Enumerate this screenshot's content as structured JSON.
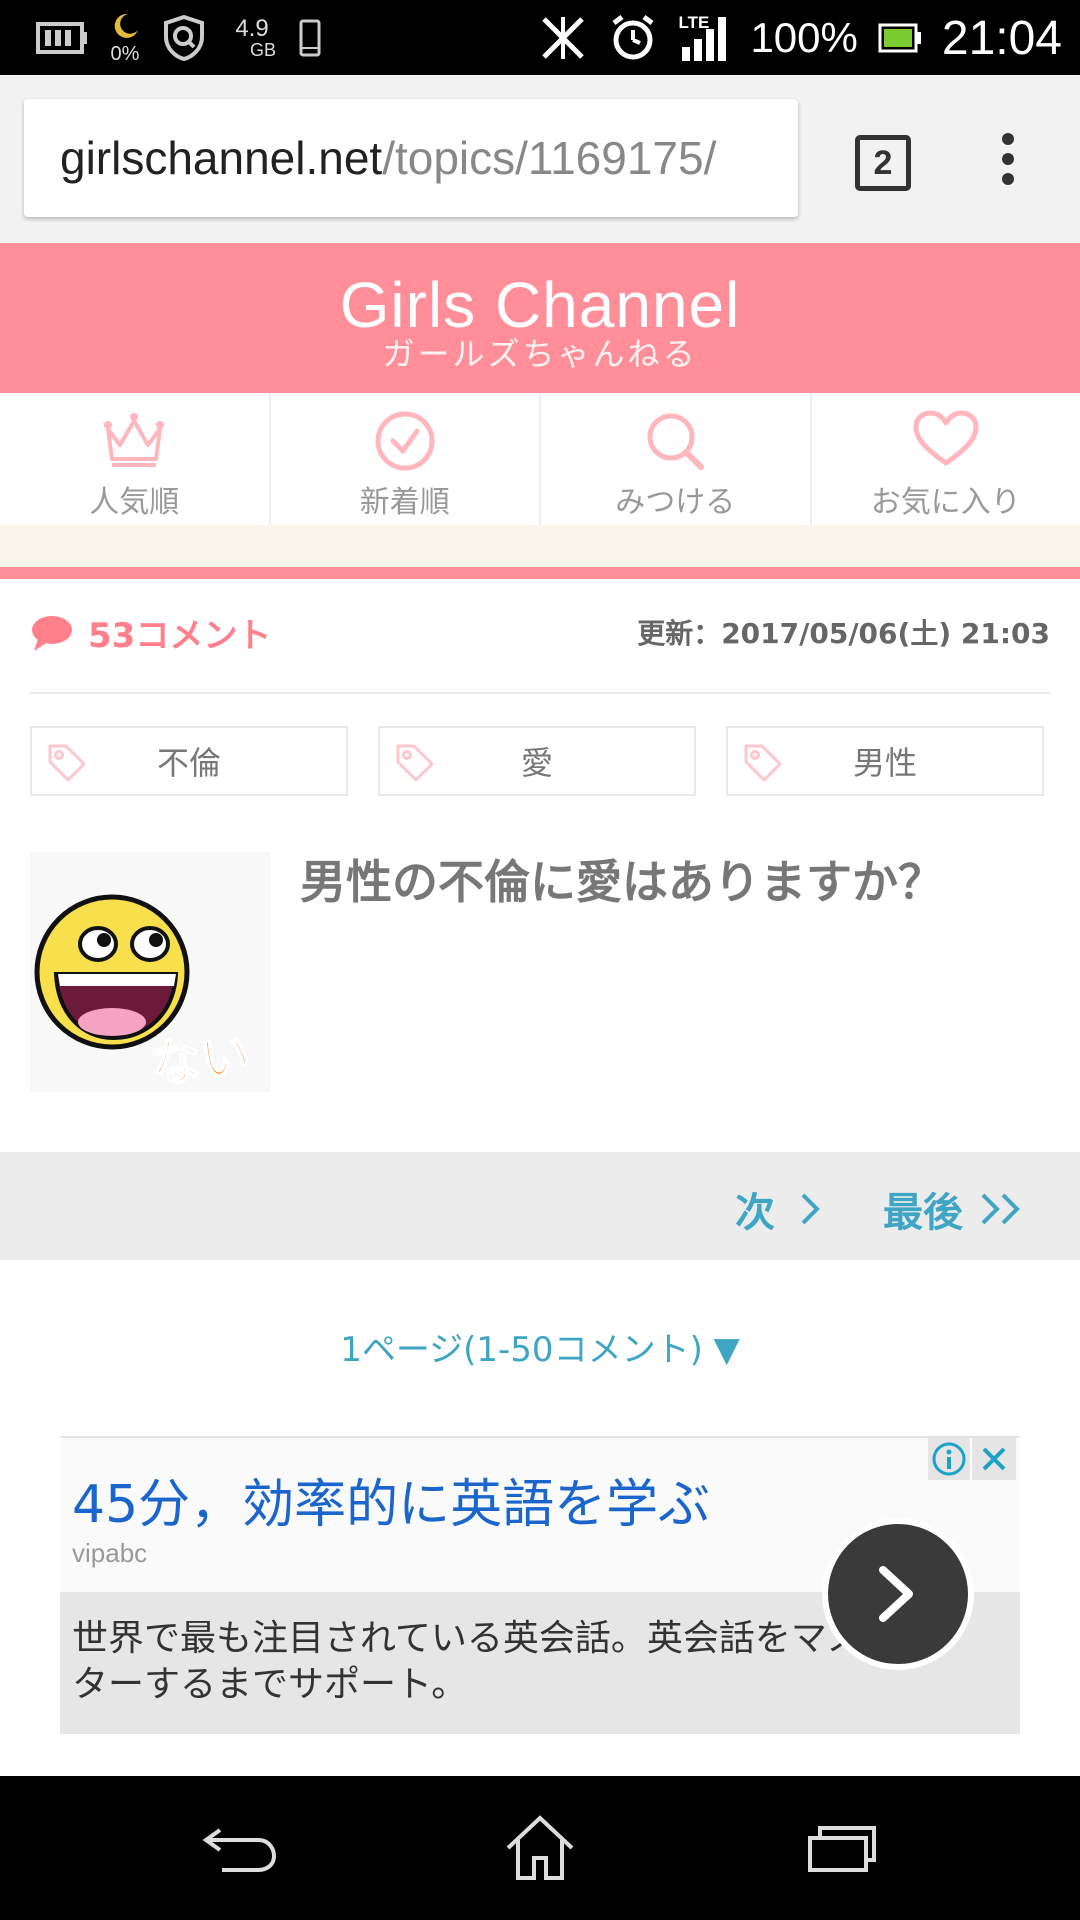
{
  "status_bar": {
    "battery_saver": "0%",
    "storage": "4.9",
    "storage_unit": "GB",
    "network": "LTE",
    "battery": "100%",
    "time": "21:04"
  },
  "browser": {
    "url_domain": "girlschannel.net",
    "url_path": "/topics/1169175/",
    "tab_count": "2"
  },
  "site": {
    "logo_en": "Girls Channel",
    "logo_jp": "ガールズちゃんねる"
  },
  "nav": [
    {
      "label": "人気順",
      "icon": "crown-icon"
    },
    {
      "label": "新着順",
      "icon": "clock-icon"
    },
    {
      "label": "みつける",
      "icon": "search-icon"
    },
    {
      "label": "お気に入り",
      "icon": "heart-icon"
    }
  ],
  "topic": {
    "comment_count": "53コメント",
    "updated": "更新：2017/05/06(土) 21:03",
    "tags": [
      "不倫",
      "愛",
      "男性"
    ],
    "title": "男性の不倫に愛はありますか？",
    "thumbnail_caption": "ない"
  },
  "pager": {
    "next": "次",
    "last": "最後",
    "page_info": "1ページ(1-50コメント) ▼"
  },
  "ad": {
    "headline": "45分，効率的に英語を学ぶ",
    "source": "vipabc",
    "body": "世界で最も注目されている英会話。英会話をマスターするまでサポート。"
  },
  "colors": {
    "brand_pink": "#ff8e98",
    "link_blue": "#3fa5c4",
    "ad_blue": "#1a66cc"
  }
}
